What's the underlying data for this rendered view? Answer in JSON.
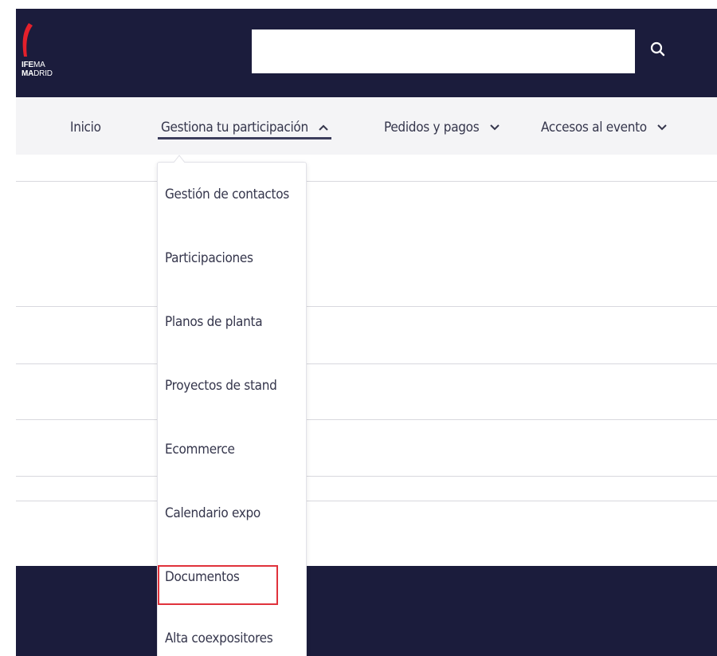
{
  "header": {
    "logo": {
      "line1_bold": "IFE",
      "line1_rest": "MA",
      "line2_bold": "MA",
      "line2_rest": "DRID"
    },
    "search": {
      "value": "",
      "placeholder": "",
      "icon": "search-icon"
    }
  },
  "nav": {
    "items": [
      {
        "label": "Inicio",
        "icon": ""
      },
      {
        "label": "Gestiona tu participación",
        "icon": "chevron-up-icon",
        "active": true
      },
      {
        "label": "Pedidos y pagos",
        "icon": "chevron-down-icon"
      },
      {
        "label": "Accesos al evento",
        "icon": "chevron-down-icon"
      }
    ]
  },
  "dropdown": {
    "items": [
      {
        "label": "Gestión de contactos"
      },
      {
        "label": "Participaciones"
      },
      {
        "label": "Planos de planta"
      },
      {
        "label": "Proyectos de stand"
      },
      {
        "label": "Ecommerce"
      },
      {
        "label": "Calendario expo"
      },
      {
        "label": "Documentos",
        "highlighted": true
      },
      {
        "label": "Alta coexpositores"
      }
    ]
  },
  "colors": {
    "navy": "#1b1c3c",
    "nav_bg": "#f4f4f6",
    "text": "#35364c",
    "highlight": "#e0323b",
    "brand_red": "#e4202b"
  }
}
